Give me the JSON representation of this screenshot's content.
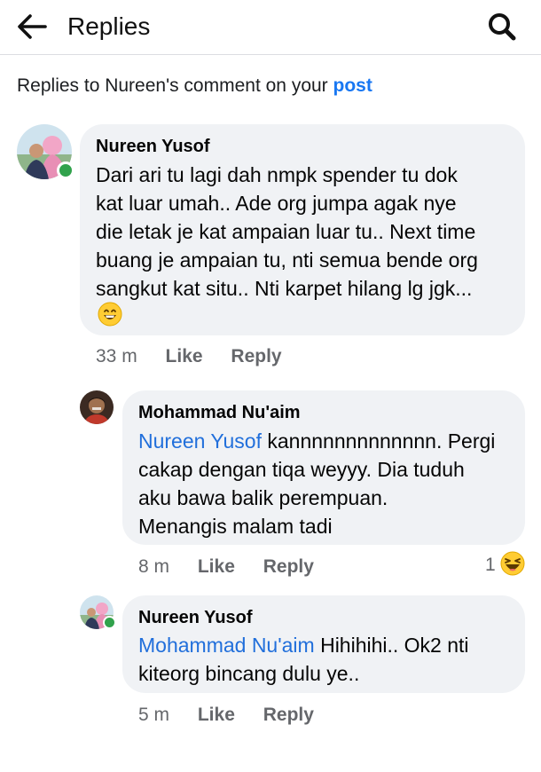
{
  "header": {
    "title": "Replies",
    "back_icon": "arrow-left-icon",
    "search_icon": "search-icon"
  },
  "context": {
    "prefix": "Replies to Nureen's comment on your ",
    "link": "post"
  },
  "comments": [
    {
      "author": "Nureen Yusof",
      "mention": "",
      "text_lines": [
        "Dari ari tu lagi dah nmpk spender tu dok",
        "kat luar umah.. Ade org jumpa agak nye",
        "die letak je kat ampaian luar tu.. Next time",
        "buang je ampaian tu, nti semua bende org",
        "sangkut kat situ.. Nti karpet hilang lg jgk..."
      ],
      "emoji": "😄",
      "time": "33 m",
      "like": "Like",
      "reply": "Reply",
      "online": true
    },
    {
      "author": "Mohammad Nu'aim",
      "mention": "Nureen Yusof",
      "first_line_rest": " kannnnnnnnnnnnn. Pergi",
      "text_lines": [
        "cakap dengan tiqa weyyy. Dia tuduh",
        "aku bawa balik perempuan.",
        "Menangis malam tadi"
      ],
      "time": "8 m",
      "like": "Like",
      "reply": "Reply",
      "reaction_count": "1",
      "reaction_icon": "haha-reaction-icon",
      "online": false
    },
    {
      "author": "Nureen Yusof",
      "mention": "Mohammad Nu'aim",
      "first_line_rest": " Hihihihi.. Ok2 nti",
      "text_lines": [
        "kiteorg bincang dulu ye.."
      ],
      "time": "5 m",
      "like": "Like",
      "reply": "Reply",
      "online": true
    }
  ],
  "colors": {
    "link_blue": "#1877f2",
    "mention_blue": "#216fdb",
    "bubble_bg": "#f0f2f5",
    "meta_gray": "#65676b",
    "online_green": "#31a24c"
  }
}
